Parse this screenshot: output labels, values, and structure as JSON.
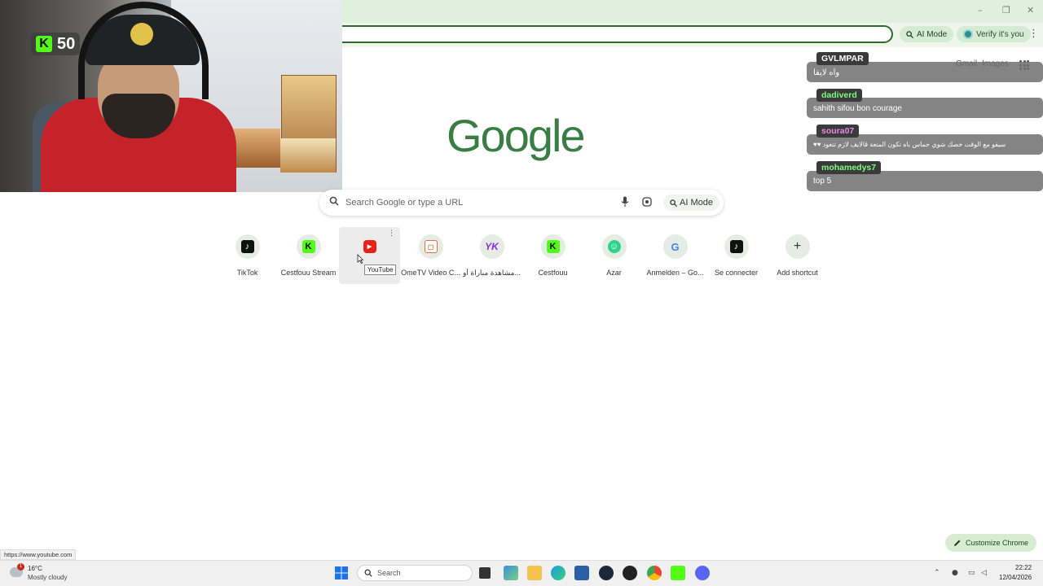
{
  "browser": {
    "ai_mode_label": "AI Mode",
    "verify_label": "Verify it's you",
    "window_controls": [
      "–",
      "❐",
      "✕"
    ]
  },
  "webcam": {
    "platform_icon": "kick-icon",
    "viewer_count": "50"
  },
  "ntp": {
    "top_links": [
      "Gmail",
      "Images"
    ],
    "logo_text": "Google",
    "search_placeholder": "Search Google or type a URL",
    "ai_mode_label": "AI Mode",
    "customize_label": "Customize Chrome",
    "shortcuts": [
      {
        "label": "TikTok",
        "icon": "tiktok-icon"
      },
      {
        "label": "Cestfouu Stream",
        "icon": "kick-icon"
      },
      {
        "label": "YouTube",
        "icon": "youtube-icon"
      },
      {
        "label": "OmeTV Video C...",
        "icon": "ometv-icon"
      },
      {
        "label": "مشاهدة مباراة أو...",
        "icon": "yk-icon"
      },
      {
        "label": "Cestfouu",
        "icon": "kick-icon"
      },
      {
        "label": "Azar",
        "icon": "azar-icon"
      },
      {
        "label": "Anmelden – Go...",
        "icon": "google-icon"
      },
      {
        "label": "Se connecter",
        "icon": "tiktok-icon"
      },
      {
        "label": "Add shortcut",
        "icon": "plus-icon"
      }
    ],
    "hover_label_visible": "Yo",
    "tooltip": "YouTube",
    "status_url": "https://www.youtube.com"
  },
  "chat": [
    {
      "user": "GVLMPAR",
      "color": "#ffffff",
      "text": "واه لايقا"
    },
    {
      "user": "dadiverd",
      "color": "#7dff7d",
      "text": "sahith sifou bon courage"
    },
    {
      "user": "soura07",
      "color": "#e58be5",
      "text": "♥♥ سيفو مع الوقت خصك شوي حماس باه تكون المتعة ڨالايف لازم تتعود"
    },
    {
      "user": "mohamedys7",
      "color": "#7dff7d",
      "text": "top 5"
    }
  ],
  "taskbar": {
    "weather_temp": "16°C",
    "weather_desc": "Mostly cloudy",
    "weather_badge": "1",
    "search_label": "Search",
    "time": "22:22",
    "date": "12/04/2026"
  },
  "colors": {
    "accent_green": "#3a7d44",
    "kick_green": "#53fc18",
    "youtube_red": "#e62117"
  }
}
